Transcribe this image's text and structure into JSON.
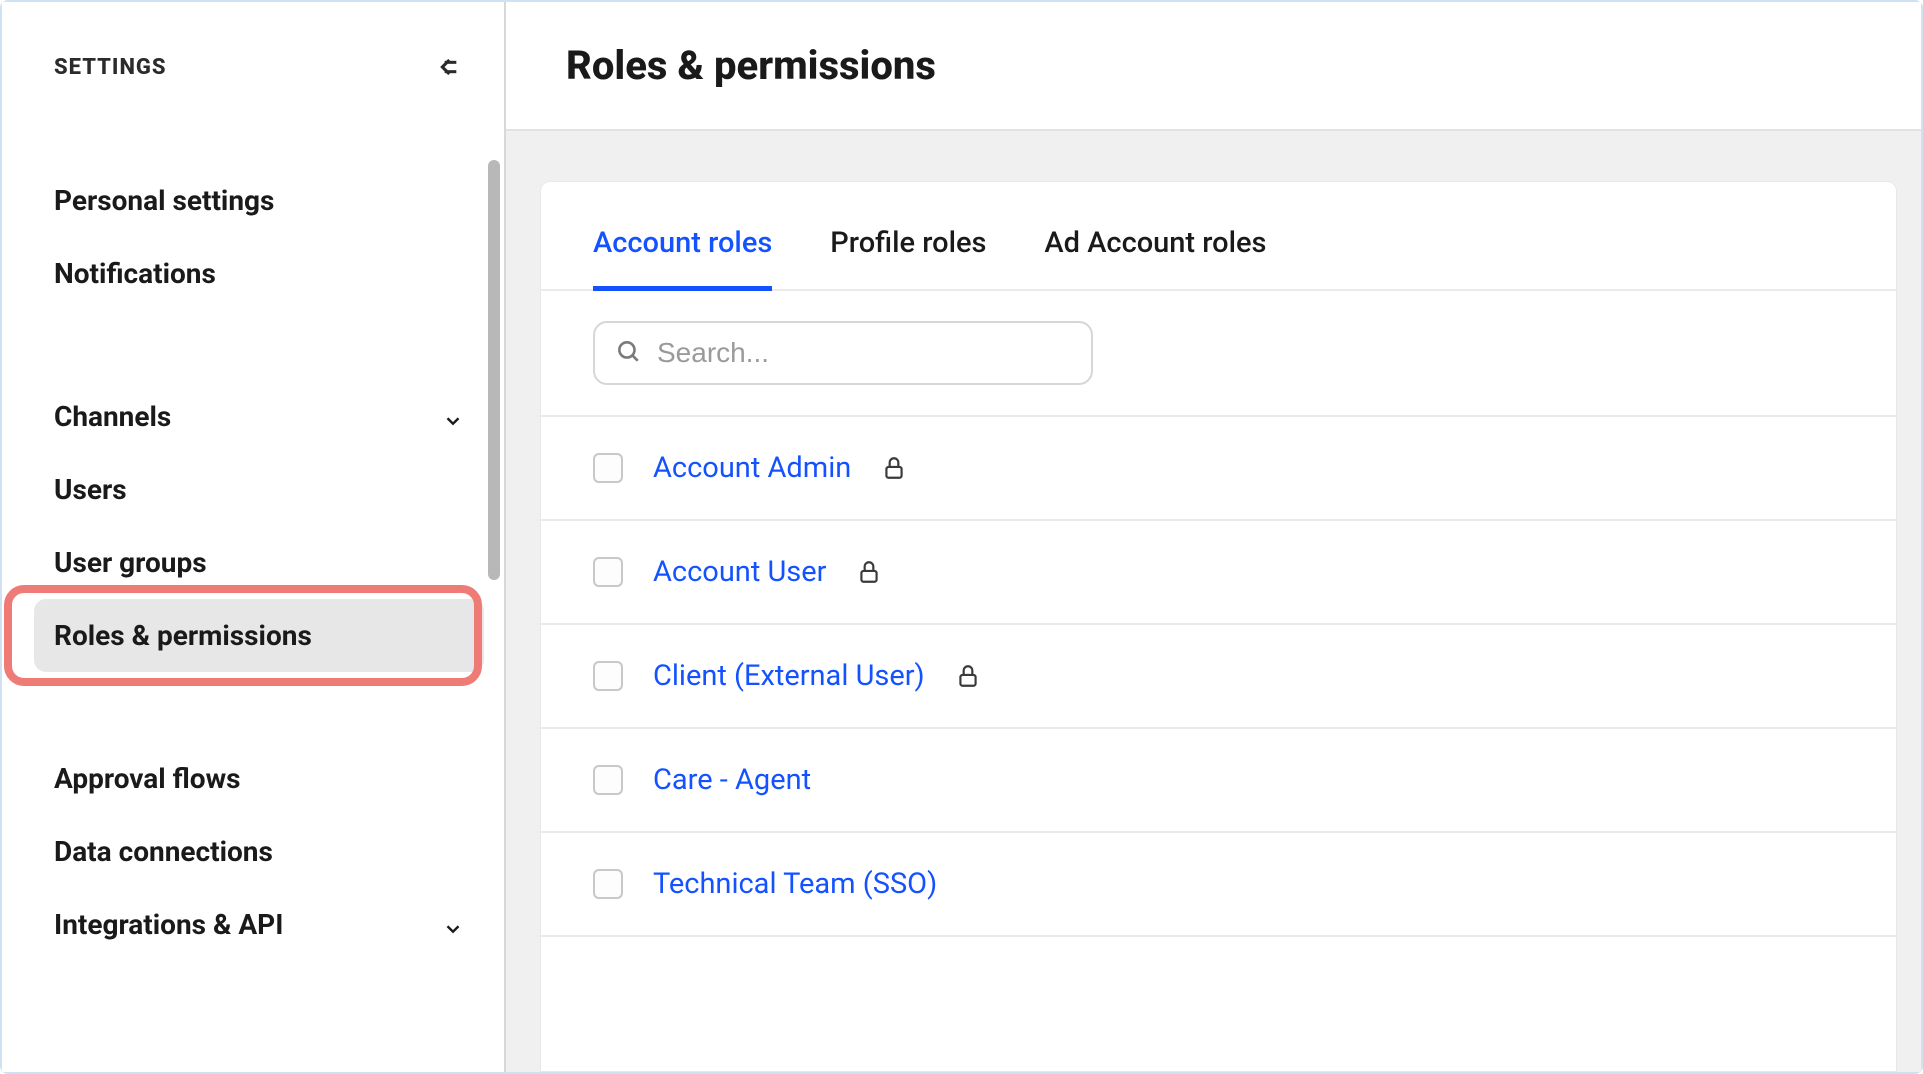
{
  "sidebar": {
    "title": "SETTINGS",
    "items": [
      {
        "label": "Personal settings",
        "expandable": false
      },
      {
        "label": "Notifications",
        "expandable": false
      },
      {
        "label": "Channels",
        "expandable": true
      },
      {
        "label": "Users",
        "expandable": false
      },
      {
        "label": "User groups",
        "expandable": false
      },
      {
        "label": "Roles & permissions",
        "expandable": false,
        "active": true
      },
      {
        "label": "Approval flows",
        "expandable": false
      },
      {
        "label": "Data connections",
        "expandable": false
      },
      {
        "label": "Integrations & API",
        "expandable": true
      }
    ]
  },
  "page": {
    "title": "Roles & permissions"
  },
  "tabs": [
    {
      "label": "Account roles",
      "active": true
    },
    {
      "label": "Profile roles",
      "active": false
    },
    {
      "label": "Ad Account roles",
      "active": false
    }
  ],
  "search": {
    "placeholder": "Search..."
  },
  "roles": [
    {
      "name": "Account Admin",
      "locked": true
    },
    {
      "name": "Account User",
      "locked": true
    },
    {
      "name": "Client (External User)",
      "locked": true
    },
    {
      "name": "Care - Agent",
      "locked": false
    },
    {
      "name": "Technical Team (SSO)",
      "locked": false
    }
  ]
}
